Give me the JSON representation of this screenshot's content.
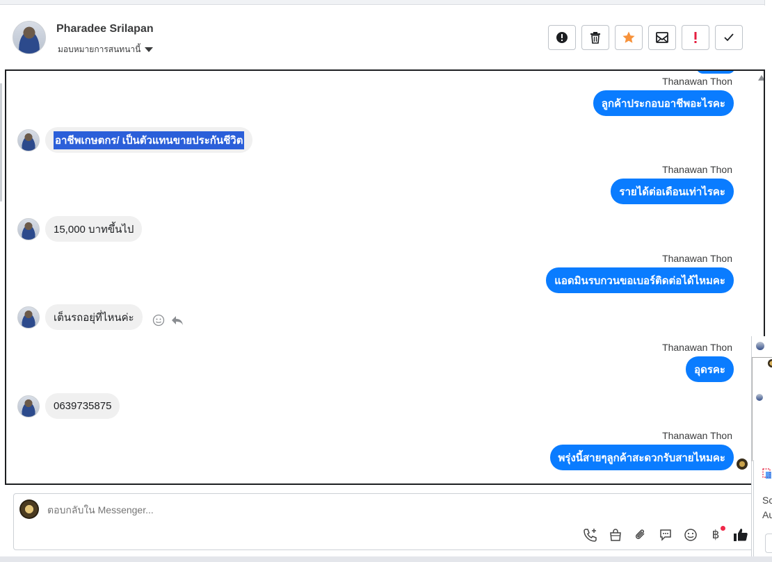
{
  "header": {
    "contact_name": "Pharadee Srilapan",
    "assign_label": "มอบหมายการสนทนานี้"
  },
  "toolbar": {
    "buttons": [
      {
        "name": "mark-spam",
        "icon": "alert-circle-icon",
        "color": "#1c1e21"
      },
      {
        "name": "delete",
        "icon": "trash-icon",
        "color": "#1c1e21"
      },
      {
        "name": "star",
        "icon": "star-icon",
        "color": "#f7923b"
      },
      {
        "name": "mark-unread",
        "icon": "envelope-open-icon",
        "color": "#1c1e21"
      },
      {
        "name": "follow-up",
        "icon": "exclamation-icon",
        "color": "#e41e3f"
      },
      {
        "name": "mark-done",
        "icon": "check-icon",
        "color": "#1c1e21"
      }
    ]
  },
  "messages": [
    {
      "side": "out",
      "sender": "Thanawan Thon",
      "text": "ลูกค้าประกอบอาชีพอะไรคะ"
    },
    {
      "side": "in",
      "text": "อาชีพเกษตกร/ เป็นตัวแทนขายประกันชีวิต",
      "selected": true
    },
    {
      "side": "out",
      "sender": "Thanawan Thon",
      "text": "รายได้ต่อเดือนเท่าไรคะ"
    },
    {
      "side": "in",
      "text": "15,000  บาทขึ้นไป"
    },
    {
      "side": "out",
      "sender": "Thanawan Thon",
      "text": "แอดมินรบกวนขอเบอร์ติดต่อได้ไหมคะ"
    },
    {
      "side": "in",
      "text": "เต็นรถอยุ่ที่ไหนค่ะ"
    },
    {
      "side": "out",
      "sender": "Thanawan Thon",
      "text": "อุดรคะ"
    },
    {
      "side": "in",
      "text": "0639735875"
    },
    {
      "side": "out",
      "sender": "Thanawan Thon",
      "text": "พรุ่งนี้สายๆลูกค้าสะดวกรับสายไหมคะ"
    }
  ],
  "composer": {
    "placeholder": "ตอบกลับใน Messenger...",
    "icons": [
      "phone-add-icon",
      "shopping-bag-icon",
      "paperclip-icon",
      "chat-bubble-icon",
      "emoji-icon",
      "baht-icon",
      "thumbs-up-icon"
    ],
    "baht_symbol": "฿"
  },
  "right_pane": {
    "text_1": "Sc",
    "text_2": "Au"
  }
}
